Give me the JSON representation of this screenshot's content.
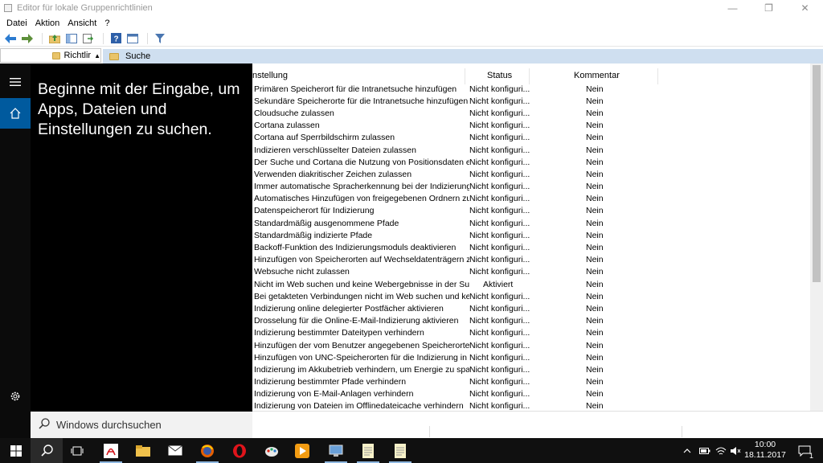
{
  "window": {
    "title": "Editor für lokale Gruppenrichtlinien",
    "minimize_glyph": "—",
    "maximize_glyph": "❐",
    "close_glyph": "✕"
  },
  "menu": {
    "items": [
      "Datei",
      "Aktion",
      "Ansicht",
      "?"
    ]
  },
  "tree": {
    "label": "Richtlir"
  },
  "details": {
    "folder_title": "Suche",
    "columns": {
      "name": "Einstellung",
      "name_visible": "nstellung",
      "status": "Status",
      "comment": "Kommentar"
    },
    "rows": [
      {
        "name": "Primären Speicherort für die Intranetsuche hinzufügen",
        "status": "Nicht konfiguri...",
        "comment": "Nein"
      },
      {
        "name": "Sekundäre Speicherorte für die Intranetsuche hinzufügen",
        "status": "Nicht konfiguri...",
        "comment": "Nein"
      },
      {
        "name": "Cloudsuche zulassen",
        "status": "Nicht konfiguri...",
        "comment": "Nein"
      },
      {
        "name": "Cortana zulassen",
        "status": "Nicht konfiguri...",
        "comment": "Nein"
      },
      {
        "name": "Cortana auf Sperrbildschirm zulassen",
        "status": "Nicht konfiguri...",
        "comment": "Nein"
      },
      {
        "name": "Indizieren verschlüsselter Dateien zulassen",
        "status": "Nicht konfiguri...",
        "comment": "Nein"
      },
      {
        "name": "Der Suche und Cortana die Nutzung von Positionsdaten erla...",
        "status": "Nicht konfiguri...",
        "comment": "Nein"
      },
      {
        "name": "Verwenden diakritischer Zeichen zulassen",
        "status": "Nicht konfiguri...",
        "comment": "Nein"
      },
      {
        "name": "Immer automatische Spracherkennung bei der Indizierung vo...",
        "status": "Nicht konfiguri...",
        "comment": "Nein"
      },
      {
        "name": "Automatisches Hinzufügen von freigegebenen Ordnern zum ...",
        "status": "Nicht konfiguri...",
        "comment": "Nein"
      },
      {
        "name": "Datenspeicherort für Indizierung",
        "status": "Nicht konfiguri...",
        "comment": "Nein"
      },
      {
        "name": "Standardmäßig ausgenommene Pfade",
        "status": "Nicht konfiguri...",
        "comment": "Nein"
      },
      {
        "name": "Standardmäßig indizierte Pfade",
        "status": "Nicht konfiguri...",
        "comment": "Nein"
      },
      {
        "name": "Backoff-Funktion des Indizierungsmoduls deaktivieren",
        "status": "Nicht konfiguri...",
        "comment": "Nein"
      },
      {
        "name": "Hinzufügen von Speicherorten auf Wechseldatenträgern zu B...",
        "status": "Nicht konfiguri...",
        "comment": "Nein"
      },
      {
        "name": "Websuche nicht zulassen",
        "status": "Nicht konfiguri...",
        "comment": "Nein"
      },
      {
        "name": "Nicht im Web suchen und keine Webergebnisse in der Suche...",
        "status": "Aktiviert",
        "comment": "Nein"
      },
      {
        "name": "Bei getakteten Verbindungen nicht im Web suchen und kein...",
        "status": "Nicht konfiguri...",
        "comment": "Nein"
      },
      {
        "name": "Indizierung online delegierter Postfächer aktivieren",
        "status": "Nicht konfiguri...",
        "comment": "Nein"
      },
      {
        "name": "Drosselung für die Online-E-Mail-Indizierung aktivieren",
        "status": "Nicht konfiguri...",
        "comment": "Nein"
      },
      {
        "name": "Indizierung bestimmter Dateitypen verhindern",
        "status": "Nicht konfiguri...",
        "comment": "Nein"
      },
      {
        "name": "Hinzufügen der vom Benutzer angegebenen Speicherorte zu...",
        "status": "Nicht konfiguri...",
        "comment": "Nein"
      },
      {
        "name": "Hinzufügen von UNC-Speicherorten für die Indizierung in de...",
        "status": "Nicht konfiguri...",
        "comment": "Nein"
      },
      {
        "name": "Indizierung im Akkubetrieb verhindern, um Energie zu sparen",
        "status": "Nicht konfiguri...",
        "comment": "Nein"
      },
      {
        "name": "Indizierung bestimmter Pfade verhindern",
        "status": "Nicht konfiguri...",
        "comment": "Nein"
      },
      {
        "name": "Indizierung von E-Mail-Anlagen verhindern",
        "status": "Nicht konfiguri...",
        "comment": "Nein"
      },
      {
        "name": "Indizierung von Dateien im Offlinedateicache verhindern",
        "status": "Nicht konfiguri...",
        "comment": "Nein"
      }
    ]
  },
  "start": {
    "prompt": "Beginne mit der Eingabe, um Apps, Dateien und Einstellungen zu suchen.",
    "search_placeholder": "Windows durchsuchen"
  },
  "taskbar": {
    "time": "10:00",
    "date": "18.11.2017",
    "notification_count": "1"
  },
  "colors": {
    "accent": "#005a9e",
    "search_header": "#cfdff0",
    "taskbar": "#101010"
  }
}
